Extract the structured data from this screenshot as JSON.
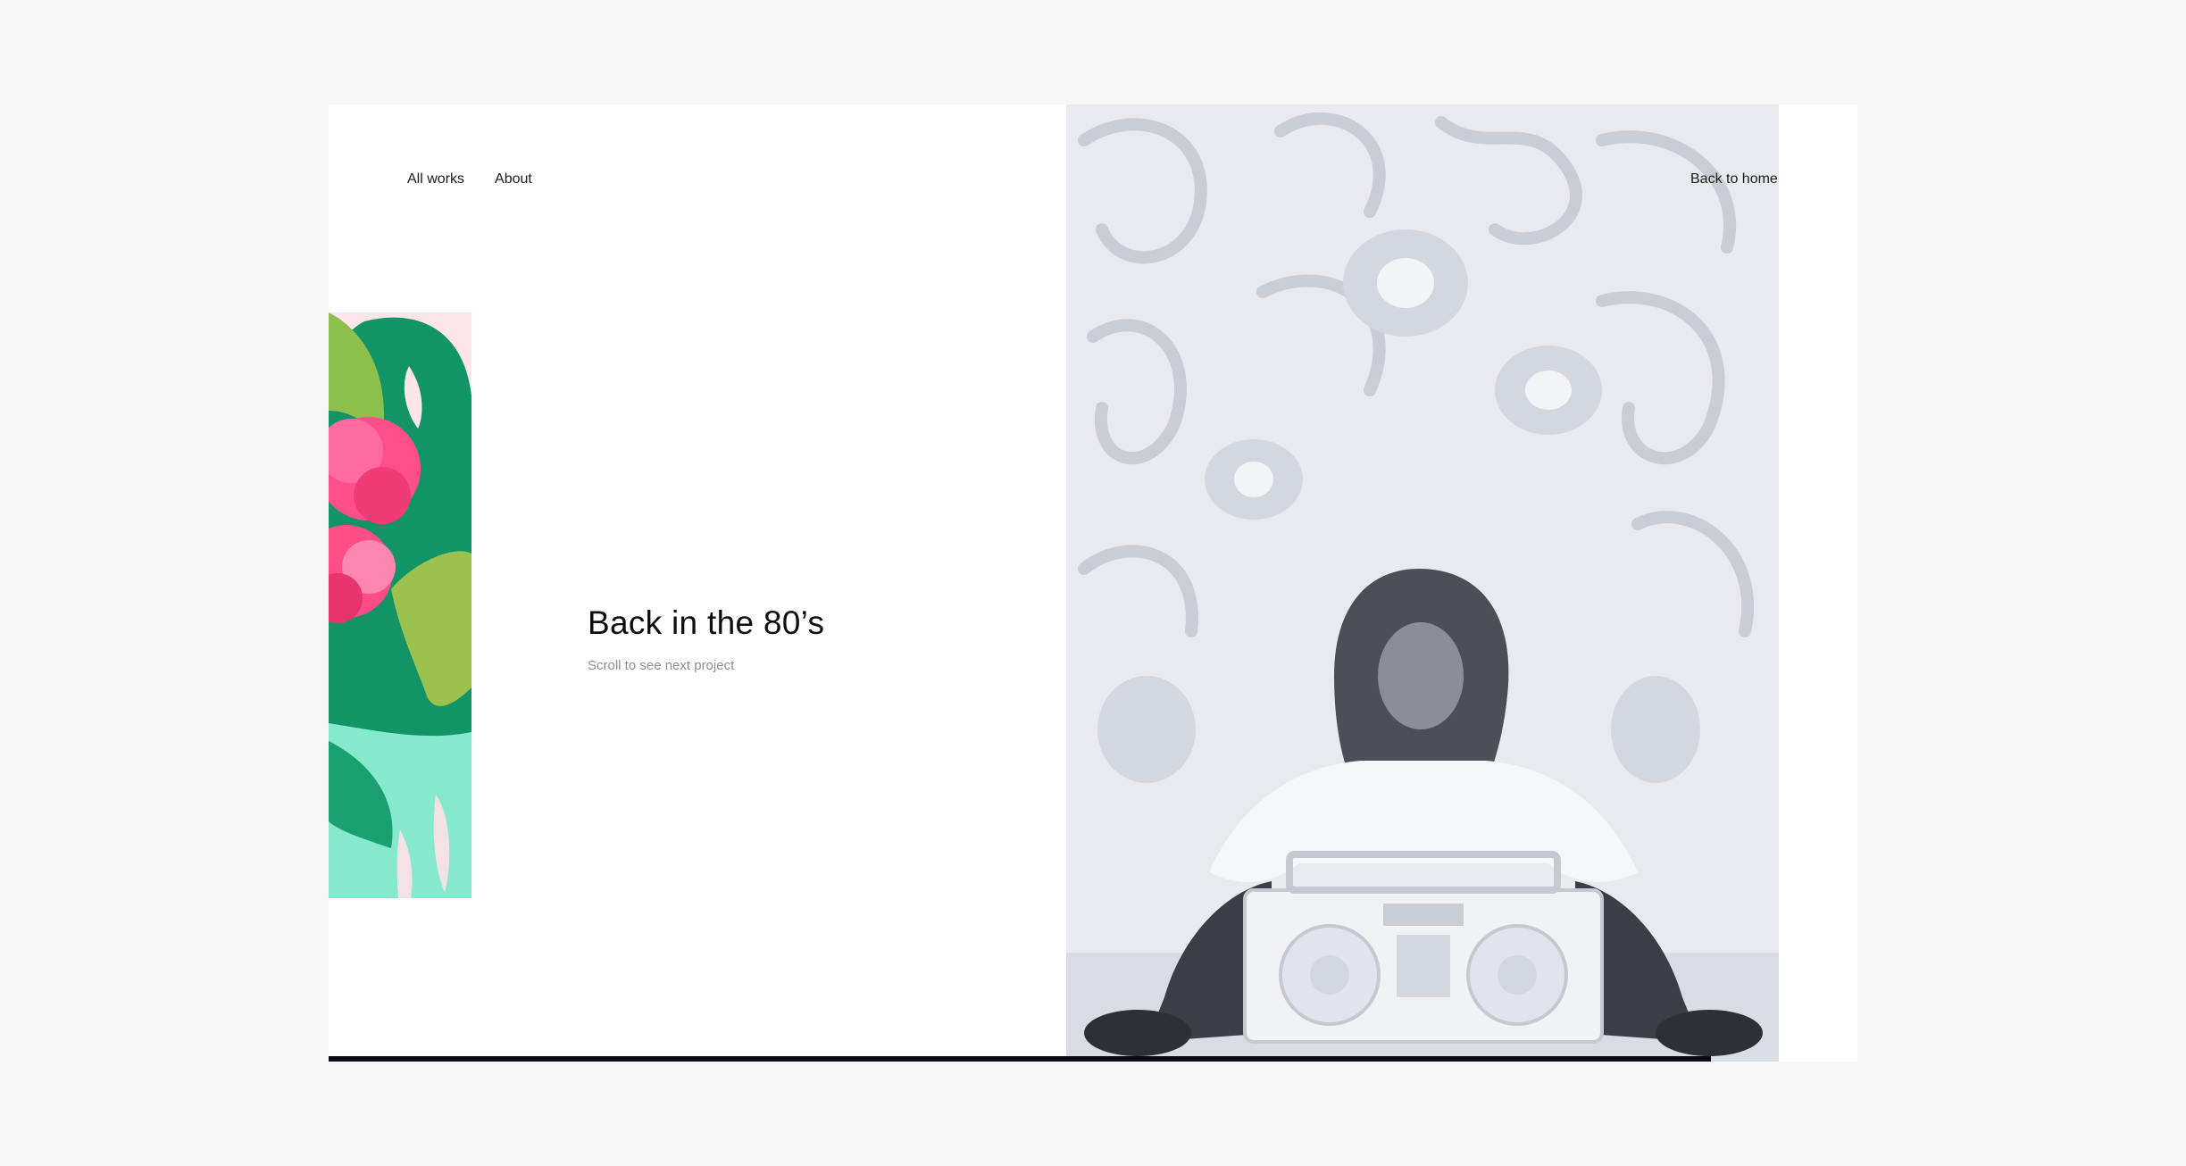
{
  "nav": {
    "items": [
      {
        "label": "All works"
      },
      {
        "label": "About"
      }
    ],
    "back_label": "Back to home"
  },
  "project": {
    "title": "Back in the 80’s",
    "hint": "Scroll to see next project"
  },
  "progress": {
    "fraction": 0.904
  },
  "colors": {
    "background": "#f7f7f7",
    "frame": "#ffffff",
    "hero_tint": "#e9ebf1",
    "progress": "#0b0b12",
    "leaf_green": "#1ea06a",
    "flower_pink": "#f2427a",
    "mint": "#7ee6c8"
  }
}
